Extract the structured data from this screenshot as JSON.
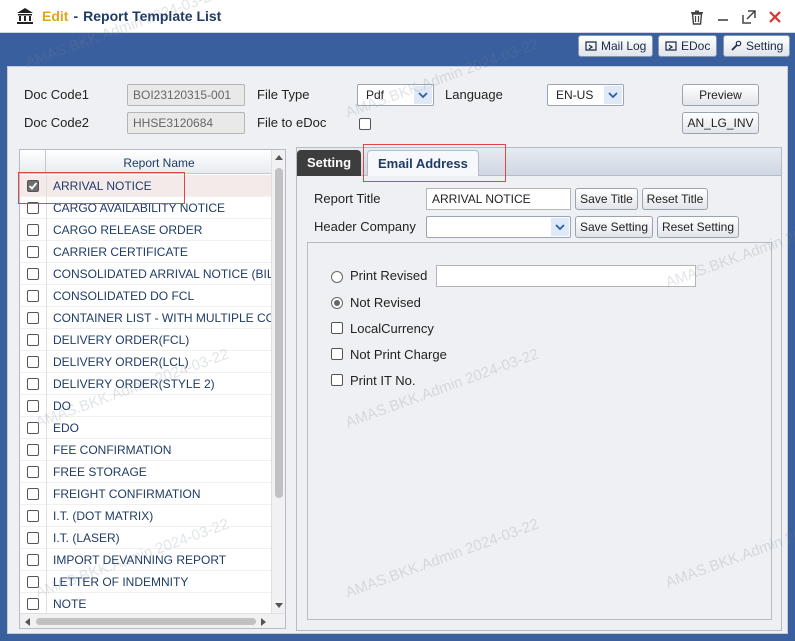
{
  "window": {
    "mode": "Edit",
    "separator": "-",
    "title": "Report Template List"
  },
  "toolbar": {
    "mail_log": "Mail Log",
    "edoc": "EDoc",
    "setting": "Setting"
  },
  "form": {
    "doc_code1_label": "Doc Code1",
    "doc_code1_value": "BOI23120315-001",
    "doc_code2_label": "Doc Code2",
    "doc_code2_value": "HHSE3120684",
    "file_type_label": "File Type",
    "file_type_value": "Pdf",
    "file_to_edoc_label": "File to eDoc",
    "file_to_edoc_checked": false,
    "language_label": "Language",
    "language_value": "EN-US",
    "preview_button": "Preview",
    "an_lg_inv_button": "AN_LG_INV"
  },
  "report_list": {
    "header": "Report Name",
    "rows": [
      {
        "name": "ARRIVAL NOTICE",
        "checked": true
      },
      {
        "name": "CARGO AVAILABILITY NOTICE",
        "checked": false
      },
      {
        "name": "CARGO RELEASE ORDER",
        "checked": false
      },
      {
        "name": "CARRIER CERTIFICATE",
        "checked": false
      },
      {
        "name": "CONSOLIDATED ARRIVAL NOTICE (BIL",
        "checked": false
      },
      {
        "name": "CONSOLIDATED DO FCL",
        "checked": false
      },
      {
        "name": "CONTAINER LIST - WITH MULTIPLE CC",
        "checked": false
      },
      {
        "name": "DELIVERY ORDER(FCL)",
        "checked": false
      },
      {
        "name": "DELIVERY ORDER(LCL)",
        "checked": false
      },
      {
        "name": "DELIVERY ORDER(STYLE 2)",
        "checked": false
      },
      {
        "name": "DO",
        "checked": false
      },
      {
        "name": "EDO",
        "checked": false
      },
      {
        "name": "FEE CONFIRMATION",
        "checked": false
      },
      {
        "name": "FREE STORAGE",
        "checked": false
      },
      {
        "name": "FREIGHT CONFIRMATION",
        "checked": false
      },
      {
        "name": "I.T. (DOT MATRIX)",
        "checked": false
      },
      {
        "name": "I.T. (LASER)",
        "checked": false
      },
      {
        "name": "IMPORT DEVANNING REPORT",
        "checked": false
      },
      {
        "name": "LETTER OF INDEMNITY",
        "checked": false
      },
      {
        "name": "NOTE",
        "checked": false
      }
    ]
  },
  "tabs": {
    "setting": "Setting",
    "email_address": "Email Address"
  },
  "settings": {
    "report_title_label": "Report Title",
    "report_title_value": "ARRIVAL NOTICE",
    "save_title": "Save Title",
    "reset_title": "Reset Title",
    "header_company_label": "Header Company",
    "header_company_value": "",
    "save_setting": "Save Setting",
    "reset_setting": "Reset Setting",
    "print_revised": "Print Revised",
    "print_revised_value": "",
    "not_revised": "Not Revised",
    "revised_selected": "Not Revised",
    "local_currency": "LocalCurrency",
    "not_print_charge": "Not Print Charge",
    "print_it_no": "Print IT No."
  },
  "watermark": "AMAS.BKK.Admin 2024-03-22",
  "colors": {
    "titlebar_accent": "#e8a21a",
    "toolbar_bg": "#3a5f9e",
    "highlight": "#e04646",
    "close_icon": "#e0302e"
  }
}
